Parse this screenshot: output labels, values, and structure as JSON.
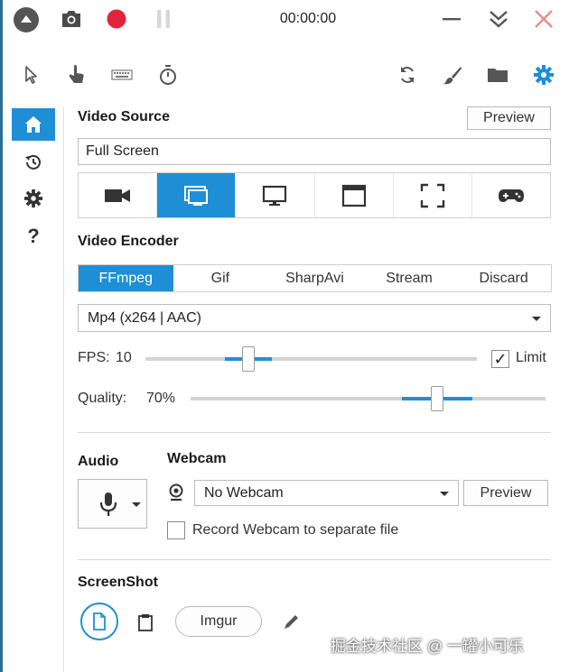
{
  "titlebar": {
    "timer": "00:00:00",
    "colors": {
      "accent": "#1e8fd6",
      "record": "#e0253a",
      "close": "#f08a8a"
    }
  },
  "toolbar": {
    "left_icons": [
      "cursor-icon",
      "hand-icon",
      "keyboard-icon",
      "stopwatch-icon"
    ],
    "right_icons": [
      "refresh-icon",
      "brush-icon",
      "folder-icon",
      "settings-gear-icon"
    ]
  },
  "sidebar": {
    "items": [
      "home-icon",
      "history-icon",
      "settings-icon",
      "help-icon"
    ],
    "help_glyph": "?"
  },
  "video_source": {
    "title": "Video Source",
    "preview_label": "Preview",
    "value": "Full Screen",
    "options": [
      "camera-icon",
      "screen-icon",
      "monitor-icon",
      "window-icon",
      "region-icon",
      "gamepad-icon"
    ],
    "selected_index": 1
  },
  "video_encoder": {
    "title": "Video Encoder",
    "tabs": [
      "FFmpeg",
      "Gif",
      "SharpAvi",
      "Stream",
      "Discard"
    ],
    "selected_index": 0,
    "codec": "Mp4 (x264 | AAC)"
  },
  "fps": {
    "label": "FPS:",
    "value": "10",
    "limit_label": "Limit",
    "limit_checked": true,
    "check_glyph": "✓"
  },
  "quality": {
    "label": "Quality:",
    "value": "70%"
  },
  "audio": {
    "title": "Audio"
  },
  "webcam": {
    "title": "Webcam",
    "selected": "No Webcam",
    "preview_label": "Preview",
    "separate_file_label": "Record Webcam to separate file"
  },
  "screenshot": {
    "title": "ScreenShot",
    "imgur_label": "Imgur"
  },
  "watermark": "掘金技术社区 @ 一罐小可乐"
}
